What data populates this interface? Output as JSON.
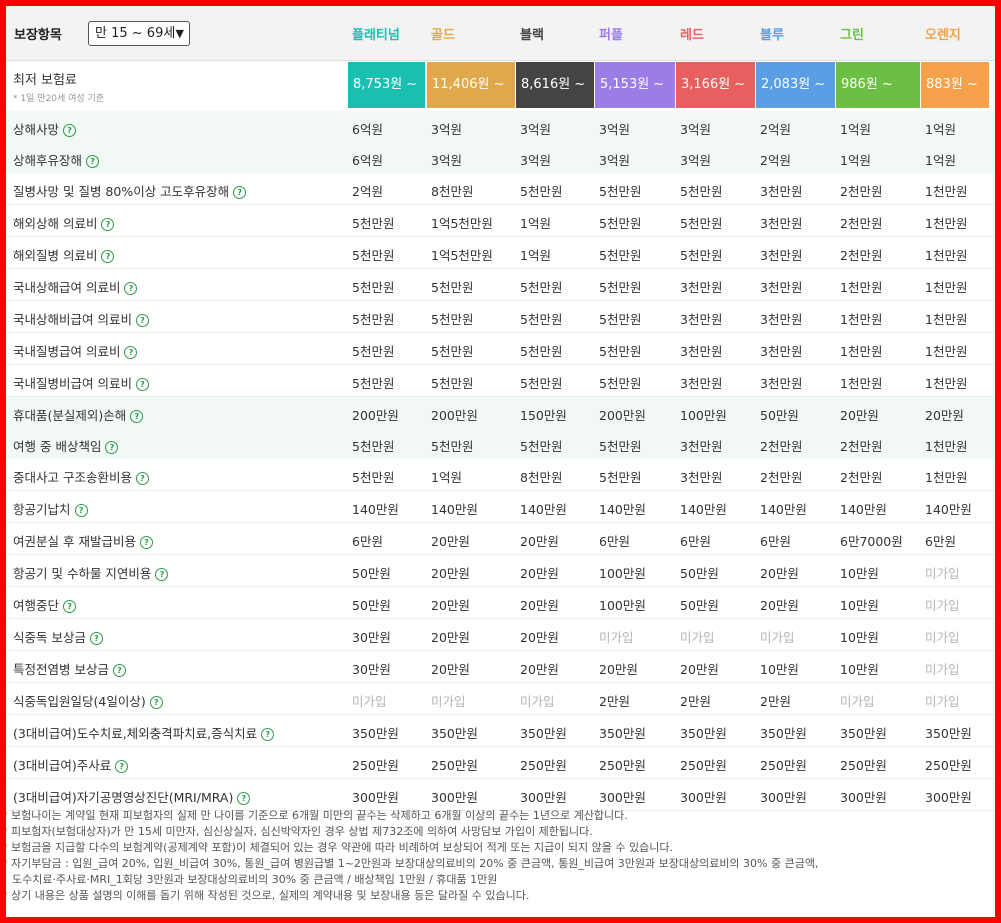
{
  "header": {
    "title": "보장항목",
    "age_select": "만 15 ~ 69세"
  },
  "plans": [
    {
      "name": "플래티넘",
      "color": "#1bbfb1",
      "price": "8,753원 ~"
    },
    {
      "name": "골드",
      "color": "#dfa94b",
      "price": "11,406원 ~"
    },
    {
      "name": "블랙",
      "color": "#444444",
      "price": "8,616원 ~"
    },
    {
      "name": "퍼플",
      "color": "#9b7de8",
      "price": "5,153원 ~"
    },
    {
      "name": "레드",
      "color": "#e85f5f",
      "price": "3,166원 ~"
    },
    {
      "name": "블루",
      "color": "#5a9ee6",
      "price": "2,083원 ~"
    },
    {
      "name": "그린",
      "color": "#6bc043",
      "price": "986원 ~"
    },
    {
      "name": "오렌지",
      "color": "#f5a04a",
      "price": "883원 ~"
    }
  ],
  "premium": {
    "label": "최저 보험료",
    "note": "* 1일 만20세 여성 기준"
  },
  "rows": [
    {
      "label": "상해사망",
      "highlight": true,
      "values": [
        "6억원",
        "3억원",
        "3억원",
        "3억원",
        "3억원",
        "2억원",
        "1억원",
        "1억원"
      ]
    },
    {
      "label": "상해후유장해",
      "highlight": true,
      "values": [
        "6억원",
        "3억원",
        "3억원",
        "3억원",
        "3억원",
        "2억원",
        "1억원",
        "1억원"
      ]
    },
    {
      "label": "질병사망 및 질병 80%이상 고도후유장해",
      "highlight": false,
      "values": [
        "2억원",
        "8천만원",
        "5천만원",
        "5천만원",
        "5천만원",
        "3천만원",
        "2천만원",
        "1천만원"
      ]
    },
    {
      "label": "해외상해 의료비",
      "highlight": false,
      "values": [
        "5천만원",
        "1억5천만원",
        "1억원",
        "5천만원",
        "5천만원",
        "3천만원",
        "2천만원",
        "1천만원"
      ]
    },
    {
      "label": "해외질병 의료비",
      "highlight": false,
      "values": [
        "5천만원",
        "1억5천만원",
        "1억원",
        "5천만원",
        "5천만원",
        "3천만원",
        "2천만원",
        "1천만원"
      ]
    },
    {
      "label": "국내상해급여 의료비",
      "highlight": false,
      "values": [
        "5천만원",
        "5천만원",
        "5천만원",
        "5천만원",
        "3천만원",
        "3천만원",
        "1천만원",
        "1천만원"
      ]
    },
    {
      "label": "국내상해비급여 의료비",
      "highlight": false,
      "values": [
        "5천만원",
        "5천만원",
        "5천만원",
        "5천만원",
        "3천만원",
        "3천만원",
        "1천만원",
        "1천만원"
      ]
    },
    {
      "label": "국내질병급여 의료비",
      "highlight": false,
      "values": [
        "5천만원",
        "5천만원",
        "5천만원",
        "5천만원",
        "3천만원",
        "3천만원",
        "1천만원",
        "1천만원"
      ]
    },
    {
      "label": "국내질병비급여 의료비",
      "highlight": false,
      "values": [
        "5천만원",
        "5천만원",
        "5천만원",
        "5천만원",
        "3천만원",
        "3천만원",
        "1천만원",
        "1천만원"
      ]
    },
    {
      "label": "휴대품(분실제외)손해",
      "highlight": true,
      "values": [
        "200만원",
        "200만원",
        "150만원",
        "200만원",
        "100만원",
        "50만원",
        "20만원",
        "20만원"
      ]
    },
    {
      "label": "여행 중 배상책임",
      "highlight": true,
      "values": [
        "5천만원",
        "5천만원",
        "5천만원",
        "5천만원",
        "3천만원",
        "2천만원",
        "2천만원",
        "1천만원"
      ]
    },
    {
      "label": "중대사고 구조송환비용",
      "highlight": false,
      "values": [
        "5천만원",
        "1억원",
        "8천만원",
        "5천만원",
        "3천만원",
        "2천만원",
        "2천만원",
        "1천만원"
      ]
    },
    {
      "label": "항공기납치",
      "highlight": false,
      "values": [
        "140만원",
        "140만원",
        "140만원",
        "140만원",
        "140만원",
        "140만원",
        "140만원",
        "140만원"
      ]
    },
    {
      "label": "여권분실 후 재발급비용",
      "highlight": false,
      "values": [
        "6만원",
        "20만원",
        "20만원",
        "6만원",
        "6만원",
        "6만원",
        "6만7000원",
        "6만원"
      ]
    },
    {
      "label": "항공기 및 수하물 지연비용",
      "highlight": false,
      "values": [
        "50만원",
        "20만원",
        "20만원",
        "100만원",
        "50만원",
        "20만원",
        "10만원",
        "미가입"
      ]
    },
    {
      "label": "여행중단",
      "highlight": false,
      "values": [
        "50만원",
        "20만원",
        "20만원",
        "100만원",
        "50만원",
        "20만원",
        "10만원",
        "미가입"
      ]
    },
    {
      "label": "식중독 보상금",
      "highlight": false,
      "values": [
        "30만원",
        "20만원",
        "20만원",
        "미가입",
        "미가입",
        "미가입",
        "10만원",
        "미가입"
      ]
    },
    {
      "label": "특정전염병 보상금",
      "highlight": false,
      "values": [
        "30만원",
        "20만원",
        "20만원",
        "20만원",
        "20만원",
        "10만원",
        "10만원",
        "미가입"
      ]
    },
    {
      "label": "식중독입원일당(4일이상)",
      "highlight": false,
      "values": [
        "미가입",
        "미가입",
        "미가입",
        "2만원",
        "2만원",
        "2만원",
        "미가입",
        "미가입"
      ]
    },
    {
      "label": "(3대비급여)도수치료,체외충격파치료,증식치료",
      "highlight": false,
      "values": [
        "350만원",
        "350만원",
        "350만원",
        "350만원",
        "350만원",
        "350만원",
        "350만원",
        "350만원"
      ]
    },
    {
      "label": "(3대비급여)주사료",
      "highlight": false,
      "values": [
        "250만원",
        "250만원",
        "250만원",
        "250만원",
        "250만원",
        "250만원",
        "250만원",
        "250만원"
      ]
    },
    {
      "label": "(3대비급여)자기공명영상진단(MRI/MRA)",
      "highlight": false,
      "values": [
        "300만원",
        "300만원",
        "300만원",
        "300만원",
        "300만원",
        "300만원",
        "300만원",
        "300만원"
      ]
    }
  ],
  "not_covered": "미가입",
  "notes": [
    "* 보험나이는 계약일 현재 피보험자의 실제 만 나이를 기준으로 6개월 미만의 끝수는 삭제하고 6개월 이상의 끝수는 1년으로 계산합니다.",
    "* 피보험자(보험대상자)가 만 15세 미만자, 심신상실자, 심신박약자인 경우 상법 제732조에 의하여 사망담보 가입이 제한됩니다.",
    "* 보험금을 지급할 다수의 보험계약(공제계약 포함)이 체결되어 있는 경우 약관에 따라 비례하여 보상되어 적게 또는 지급이 되지 않을 수 있습니다.",
    "* 자기부담금 : 입원_급여 20%, 입원_비급여 30%, 통원_급여 병원급별 1~2만원과 보장대상의료비의 20% 중 큰금액, 통원_비급여 3만원과 보장대상의료비의 30% 중 큰금액,",
    "   도수치료·주사료·MRI_1회당 3만원과 보장대상의료비의 30% 중 큰금액 / 배상책임 1만원 / 휴대품 1만원",
    "* 상기 내용은 상품 설명의 이해를 돕기 위해 작성된 것으로, 실제의 계약내용 및 보장내용 등은 달라질 수 있습니다."
  ]
}
